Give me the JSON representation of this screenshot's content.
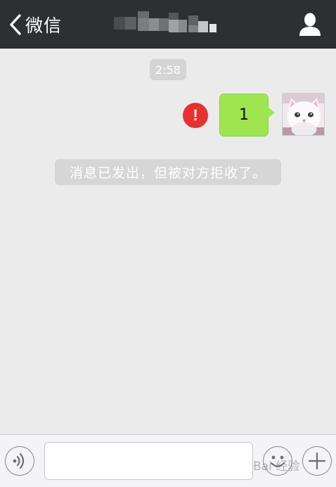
{
  "nav": {
    "back_label": "微信",
    "title": "",
    "back_icon": "chevron-left-icon",
    "profile_icon": "user-icon"
  },
  "chat": {
    "timestamp": "2:58",
    "messages": [
      {
        "text": "1",
        "direction": "outgoing",
        "status": "failed",
        "status_icon": "error-icon",
        "status_glyph": "!",
        "avatar": "white-cat-photo"
      }
    ],
    "system_notice": "消息已发出，但被对方拒收了。"
  },
  "toolbar": {
    "voice_icon": "voice-icon",
    "input_value": "",
    "input_placeholder": "",
    "emoji_icon": "emoji-icon",
    "plus_icon": "plus-icon"
  },
  "watermark": {
    "text": "Bai 经验"
  },
  "colors": {
    "nav_background": "#2d3032",
    "chat_background": "#ebebeb",
    "outgoing_bubble": "#9ee550",
    "error_red": "#e8312e",
    "system_notice_background": "#d6d6d6",
    "toolbar_background": "#f4f4f6"
  }
}
